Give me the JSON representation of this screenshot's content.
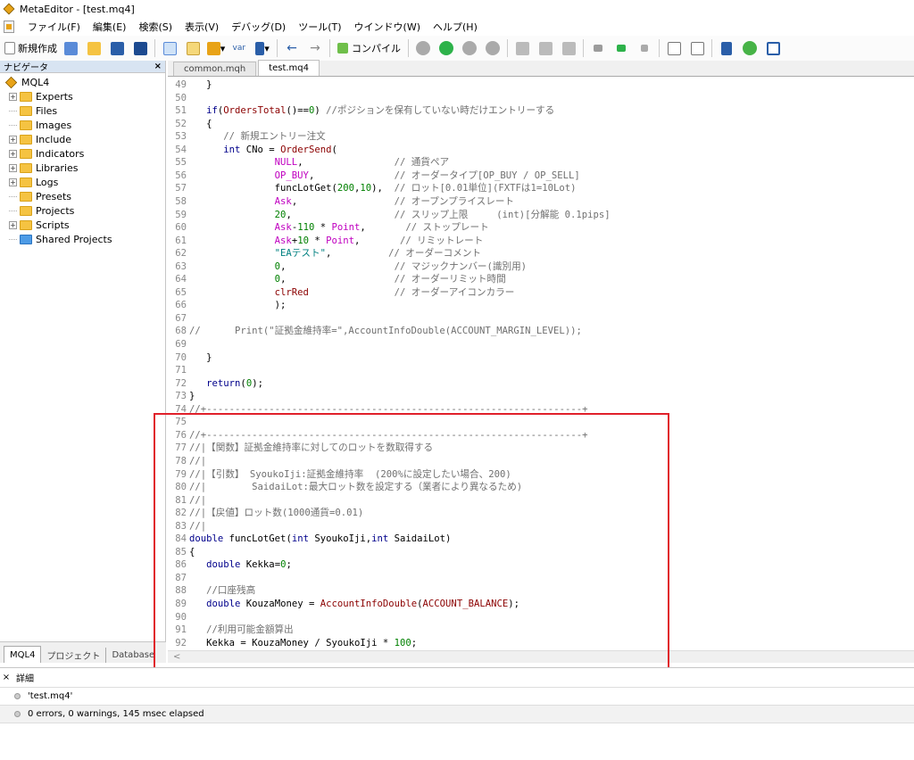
{
  "window": {
    "title": "MetaEditor - [test.mq4]"
  },
  "menu": [
    "ファイル(F)",
    "編集(E)",
    "検索(S)",
    "表示(V)",
    "デバッグ(D)",
    "ツール(T)",
    "ウインドウ(W)",
    "ヘルプ(H)"
  ],
  "toolbar": {
    "new_label": "新規作成",
    "var_label": "var",
    "compile_label": "コンパイル",
    "back_arrow": "←",
    "forward_arrow": "→"
  },
  "navigator": {
    "title": "ナビゲータ",
    "close": "×",
    "root": "MQL4",
    "items": [
      {
        "label": "Experts",
        "expandable": true
      },
      {
        "label": "Files",
        "expandable": false
      },
      {
        "label": "Images",
        "expandable": false
      },
      {
        "label": "Include",
        "expandable": true
      },
      {
        "label": "Indicators",
        "expandable": true
      },
      {
        "label": "Libraries",
        "expandable": true
      },
      {
        "label": "Logs",
        "expandable": true
      },
      {
        "label": "Presets",
        "expandable": false
      },
      {
        "label": "Projects",
        "expandable": false
      },
      {
        "label": "Scripts",
        "expandable": true
      },
      {
        "label": "Shared Projects",
        "expandable": false
      }
    ],
    "tabs": [
      "MQL4",
      "プロジェクト",
      "Database"
    ]
  },
  "editor": {
    "tabs": [
      "common.mqh",
      "test.mq4"
    ],
    "active_tab": "test.mq4",
    "lines": [
      {
        "n": "49",
        "t": [
          [
            "   }",
            "txt"
          ]
        ]
      },
      {
        "n": "50",
        "t": [
          [
            "",
            "txt"
          ]
        ]
      },
      {
        "n": "51",
        "t": [
          [
            "   ",
            "txt"
          ],
          [
            "if",
            "c-key"
          ],
          [
            "(",
            "txt"
          ],
          [
            "OrdersTotal",
            "c-fn"
          ],
          [
            "()==",
            "txt"
          ],
          [
            "0",
            "c-num"
          ],
          [
            ") ",
            "txt"
          ],
          [
            "//ポジションを保有していない時だけエントリーする",
            "c-com"
          ]
        ]
      },
      {
        "n": "52",
        "t": [
          [
            "   {",
            "txt"
          ]
        ]
      },
      {
        "n": "53",
        "t": [
          [
            "      ",
            "txt"
          ],
          [
            "// 新規エントリー注文",
            "c-com"
          ]
        ]
      },
      {
        "n": "54",
        "t": [
          [
            "      ",
            "txt"
          ],
          [
            "int",
            "c-key"
          ],
          [
            " CNo = ",
            "txt"
          ],
          [
            "OrderSend",
            "c-fn"
          ],
          [
            "(",
            "txt"
          ]
        ]
      },
      {
        "n": "55",
        "t": [
          [
            "               ",
            "txt"
          ],
          [
            "NULL",
            "c-cst"
          ],
          [
            ",                ",
            "txt"
          ],
          [
            "// 通貨ペア",
            "c-com"
          ]
        ]
      },
      {
        "n": "56",
        "t": [
          [
            "               ",
            "txt"
          ],
          [
            "OP_BUY",
            "c-cst"
          ],
          [
            ",              ",
            "txt"
          ],
          [
            "// オーダータイプ[OP_BUY / OP_SELL]",
            "c-com"
          ]
        ]
      },
      {
        "n": "57",
        "t": [
          [
            "               funcLotGet(",
            "txt"
          ],
          [
            "200",
            "c-num"
          ],
          [
            ",",
            "txt"
          ],
          [
            "10",
            "c-num"
          ],
          [
            "),  ",
            "txt"
          ],
          [
            "// ロット[0.01単位](FXTFは1=10Lot)",
            "c-com"
          ]
        ]
      },
      {
        "n": "58",
        "t": [
          [
            "               ",
            "txt"
          ],
          [
            "Ask",
            "c-cst"
          ],
          [
            ",                 ",
            "txt"
          ],
          [
            "// オープンプライスレート",
            "c-com"
          ]
        ]
      },
      {
        "n": "59",
        "t": [
          [
            "               ",
            "txt"
          ],
          [
            "20",
            "c-num"
          ],
          [
            ",                  ",
            "txt"
          ],
          [
            "// スリップ上限     (int)[分解能 0.1pips]",
            "c-com"
          ]
        ]
      },
      {
        "n": "60",
        "t": [
          [
            "               ",
            "txt"
          ],
          [
            "Ask",
            "c-cst"
          ],
          [
            "-",
            "txt"
          ],
          [
            "110",
            "c-num"
          ],
          [
            " * ",
            "txt"
          ],
          [
            "Point",
            "c-cst"
          ],
          [
            ",       ",
            "txt"
          ],
          [
            "// ストップレート",
            "c-com"
          ]
        ]
      },
      {
        "n": "61",
        "t": [
          [
            "               ",
            "txt"
          ],
          [
            "Ask",
            "c-cst"
          ],
          [
            "+",
            "txt"
          ],
          [
            "10",
            "c-num"
          ],
          [
            " * ",
            "txt"
          ],
          [
            "Point",
            "c-cst"
          ],
          [
            ",       ",
            "txt"
          ],
          [
            "// リミットレート",
            "c-com"
          ]
        ]
      },
      {
        "n": "62",
        "t": [
          [
            "               ",
            "txt"
          ],
          [
            "\"EAテスト\"",
            "c-str"
          ],
          [
            ",          ",
            "txt"
          ],
          [
            "// オーダーコメント",
            "c-com"
          ]
        ]
      },
      {
        "n": "63",
        "t": [
          [
            "               ",
            "txt"
          ],
          [
            "0",
            "c-num"
          ],
          [
            ",                   ",
            "txt"
          ],
          [
            "// マジックナンバー(識別用)",
            "c-com"
          ]
        ]
      },
      {
        "n": "64",
        "t": [
          [
            "               ",
            "txt"
          ],
          [
            "0",
            "c-num"
          ],
          [
            ",                   ",
            "txt"
          ],
          [
            "// オーダーリミット時間",
            "c-com"
          ]
        ]
      },
      {
        "n": "65",
        "t": [
          [
            "               ",
            "txt"
          ],
          [
            "clrRed",
            "c-fn"
          ],
          [
            "               ",
            "txt"
          ],
          [
            "// オーダーアイコンカラー",
            "c-com"
          ]
        ]
      },
      {
        "n": "66",
        "t": [
          [
            "               );",
            "txt"
          ]
        ]
      },
      {
        "n": "67",
        "t": [
          [
            "",
            "txt"
          ]
        ]
      },
      {
        "n": "68",
        "t": [
          [
            "//      Print(\"証拠金維持率=\",AccountInfoDouble(ACCOUNT_MARGIN_LEVEL));",
            "c-com"
          ]
        ]
      },
      {
        "n": "69",
        "t": [
          [
            "",
            "txt"
          ]
        ]
      },
      {
        "n": "70",
        "t": [
          [
            "   }",
            "txt"
          ]
        ]
      },
      {
        "n": "71",
        "t": [
          [
            "",
            "txt"
          ]
        ]
      },
      {
        "n": "72",
        "t": [
          [
            "   ",
            "txt"
          ],
          [
            "return",
            "c-key"
          ],
          [
            "(",
            "txt"
          ],
          [
            "0",
            "c-num"
          ],
          [
            ");",
            "txt"
          ]
        ]
      },
      {
        "n": "73",
        "t": [
          [
            "}",
            "txt"
          ]
        ]
      },
      {
        "n": "74",
        "t": [
          [
            "//+------------------------------------------------------------------+",
            "c-com"
          ]
        ]
      },
      {
        "n": "75",
        "t": [
          [
            "",
            "txt"
          ]
        ]
      },
      {
        "n": "76",
        "t": [
          [
            "//+------------------------------------------------------------------+",
            "c-com"
          ]
        ]
      },
      {
        "n": "77",
        "t": [
          [
            "//|【関数】証拠金維持率に対してのロットを数取得する",
            "c-com"
          ]
        ]
      },
      {
        "n": "78",
        "t": [
          [
            "//|",
            "c-com"
          ]
        ]
      },
      {
        "n": "79",
        "t": [
          [
            "//|【引数】 SyoukoIji:証拠金維持率  (200%に設定したい場合、200)",
            "c-com"
          ]
        ]
      },
      {
        "n": "80",
        "t": [
          [
            "//|        SaidaiLot:最大ロット数を設定する（業者により異なるため)",
            "c-com"
          ]
        ]
      },
      {
        "n": "81",
        "t": [
          [
            "//|",
            "c-com"
          ]
        ]
      },
      {
        "n": "82",
        "t": [
          [
            "//|【戻値】ロット数(1000通貨=0.01)",
            "c-com"
          ]
        ]
      },
      {
        "n": "83",
        "t": [
          [
            "//|",
            "c-com"
          ]
        ]
      },
      {
        "n": "84",
        "t": [
          [
            "double",
            "c-key"
          ],
          [
            " funcLotGet(",
            "txt"
          ],
          [
            "int",
            "c-key"
          ],
          [
            " SyoukoIji,",
            "txt"
          ],
          [
            "int",
            "c-key"
          ],
          [
            " SaidaiLot)",
            "txt"
          ]
        ]
      },
      {
        "n": "85",
        "t": [
          [
            "{",
            "txt"
          ]
        ]
      },
      {
        "n": "86",
        "t": [
          [
            "   ",
            "txt"
          ],
          [
            "double",
            "c-key"
          ],
          [
            " Kekka=",
            "txt"
          ],
          [
            "0",
            "c-num"
          ],
          [
            ";",
            "txt"
          ]
        ]
      },
      {
        "n": "87",
        "t": [
          [
            "",
            "txt"
          ]
        ]
      },
      {
        "n": "88",
        "t": [
          [
            "   ",
            "txt"
          ],
          [
            "//口座残高",
            "c-com"
          ]
        ]
      },
      {
        "n": "89",
        "t": [
          [
            "   ",
            "txt"
          ],
          [
            "double",
            "c-key"
          ],
          [
            " KouzaMoney = ",
            "txt"
          ],
          [
            "AccountInfoDouble",
            "c-fn"
          ],
          [
            "(",
            "txt"
          ],
          [
            "ACCOUNT_BALANCE",
            "c-fn"
          ],
          [
            ");",
            "txt"
          ]
        ]
      },
      {
        "n": "90",
        "t": [
          [
            "",
            "txt"
          ]
        ]
      },
      {
        "n": "91",
        "t": [
          [
            "   ",
            "txt"
          ],
          [
            "//利用可能金額算出",
            "c-com"
          ]
        ]
      },
      {
        "n": "92",
        "t": [
          [
            "   Kekka = KouzaMoney / SyoukoIji * ",
            "txt"
          ],
          [
            "100",
            "c-num"
          ],
          [
            ";",
            "txt"
          ]
        ]
      },
      {
        "n": "93",
        "t": [
          [
            "",
            "txt"
          ]
        ]
      }
    ]
  },
  "toolbox": {
    "close": "×",
    "title": "詳細",
    "messages": [
      "'test.mq4'",
      "0 errors, 0 warnings, 145 msec elapsed"
    ]
  },
  "colors": {
    "highlight_box": "#e0202a"
  }
}
